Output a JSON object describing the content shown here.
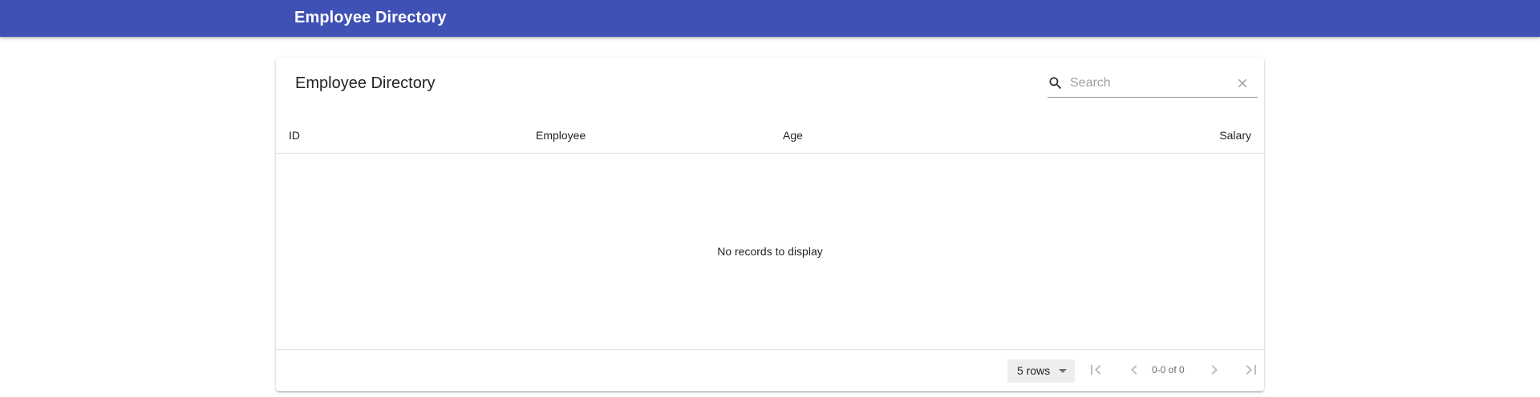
{
  "app": {
    "title": "Employee Directory"
  },
  "table": {
    "title": "Employee Directory",
    "search": {
      "placeholder": "Search",
      "value": ""
    },
    "columns": [
      "ID",
      "Employee",
      "Age",
      "Salary"
    ],
    "rows": [],
    "empty_message": "No records to display"
  },
  "pagination": {
    "rows_per_page": "5 rows",
    "range": "0-0 of 0",
    "icons": [
      "first-page-icon",
      "chevron-left-icon",
      "chevron-right-icon",
      "last-page-icon"
    ]
  },
  "colors": {
    "appbar": "#3f51b5"
  }
}
